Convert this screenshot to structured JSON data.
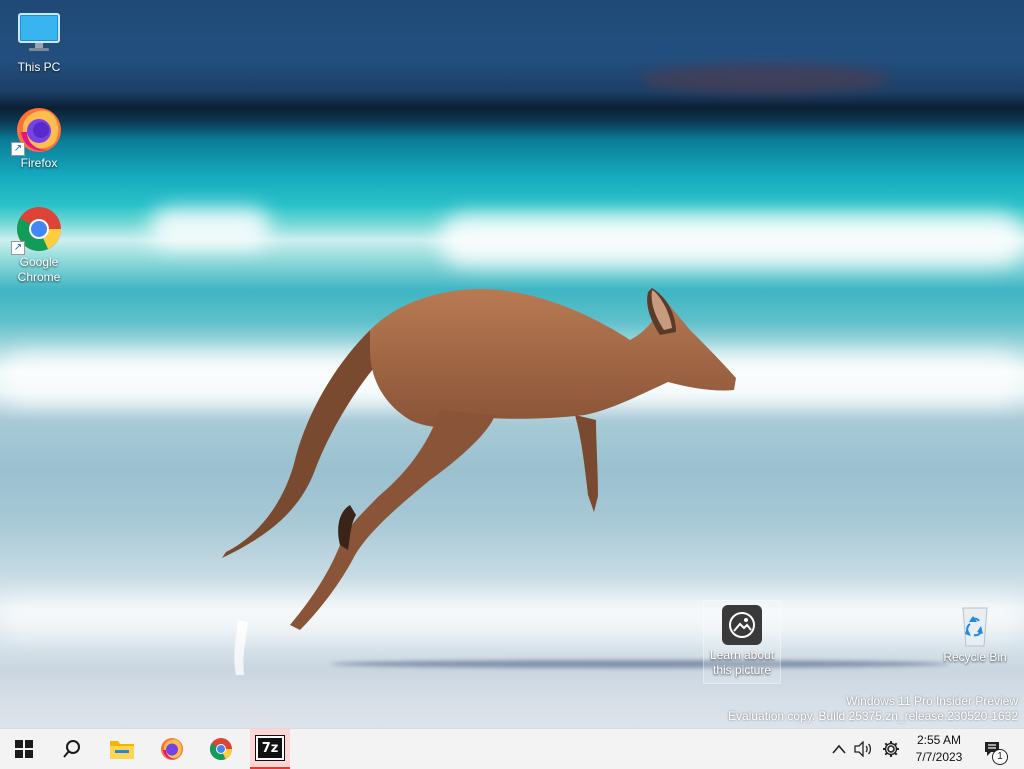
{
  "desktop": {
    "icons": [
      {
        "label": "This PC",
        "icon": "monitor-icon"
      },
      {
        "label": "Firefox",
        "icon": "firefox-icon"
      },
      {
        "label": "Google Chrome",
        "icon": "chrome-icon"
      },
      {
        "label": "Learn about this picture",
        "icon": "image-info-icon"
      },
      {
        "label": "Recycle Bin",
        "icon": "recycle-bin-icon"
      }
    ],
    "watermark": {
      "line1": "Windows 11 Pro Insider Preview",
      "line2": "Evaluation copy. Build 25375.zn_release.230520-1632"
    }
  },
  "taskbar": {
    "buttons": [
      {
        "name": "Start",
        "icon": "windows-start-icon"
      },
      {
        "name": "Search",
        "icon": "search-icon"
      },
      {
        "name": "File Explorer",
        "icon": "folder-icon"
      },
      {
        "name": "Firefox",
        "icon": "firefox-icon"
      },
      {
        "name": "Google Chrome",
        "icon": "chrome-icon"
      },
      {
        "name": "7-Zip",
        "icon": "7zip-icon",
        "label": "7z",
        "active": true
      }
    ],
    "tray": {
      "time": "2:55 AM",
      "date": "7/7/2023",
      "notification_count": "1"
    }
  },
  "colors": {
    "taskbar_bg": "#f3f3f3",
    "active_app": "#e53935",
    "accent": "#0078d4"
  }
}
